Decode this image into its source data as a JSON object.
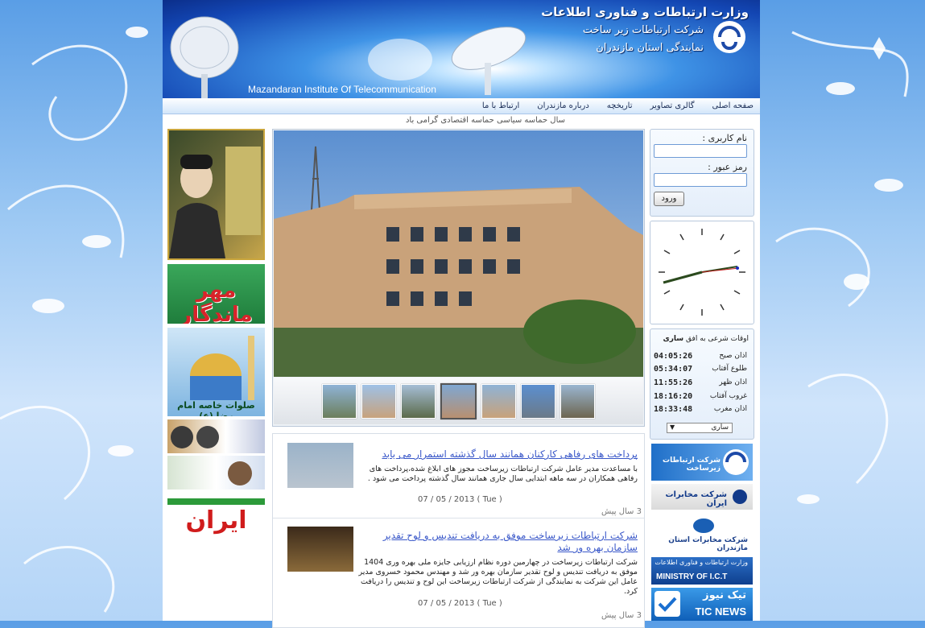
{
  "header": {
    "ministry": "وزارت ارتباطات و فناوری اطلاعات",
    "company": "شرکت ارتباطات زیر ساخت",
    "branch": "نمایندگی استان مازندران",
    "english": "Mazandaran Institute Of Telecommunication"
  },
  "nav": {
    "items": [
      "صفحه اصلی",
      "گالری تصاویر",
      "تاریخچه",
      "درباره مازندران",
      "ارتباط با ما"
    ]
  },
  "ticker": "سال حماسه سیاسی حماسه اقتصادی گرامی باد",
  "left_banners": {
    "mehr": "مهر ماندگار",
    "salavat": "صلوات خاصه امام رضا (ع)",
    "iran": "ایران"
  },
  "login": {
    "username_label": "نام کاربری :",
    "password_label": "رمز عبور :",
    "submit_label": "ورود"
  },
  "prayer": {
    "title": "اوقات شرعی به افق",
    "city": "ساری",
    "rows": [
      {
        "name": "اذان صبح",
        "time": "04:05:26"
      },
      {
        "name": "طلوع آفتاب",
        "time": "05:34:07"
      },
      {
        "name": "اذان ظهر",
        "time": "11:55:26"
      },
      {
        "name": "غروب آفتاب",
        "time": "18:16:20"
      },
      {
        "name": "اذان مغرب",
        "time": "18:33:48"
      }
    ],
    "select_value": "ساری"
  },
  "news": [
    {
      "title": "پرداخت های رفاهی کارکنان همانند سال گذشته استمرار می یابد",
      "body": "با مساعدت مدیر عامل شرکت ارتباطات زیرساخت مجوز های ابلاغ شده،پرداخت های رفاهی همکاران در سه ماهه ابتدایی سال جاری همانند سال گذشته پرداخت می شود .",
      "date": "07 / 05 / 2013 ( Tue )",
      "ago": "3 سال پیش"
    },
    {
      "title": "شرکت ارتباطات زیرساخت موفق به دریافت تندیس و لوح تقدیر سازمان بهره ور شد",
      "body": "شرکت ارتباطات زیرساخت در چهارمین دوره نظام ارزیابی جایزه ملی بهره وری 1404 موفق به دریافت تندیس و لوح تقدیر سازمان بهره ور شد و مهندس محمود خسروی مدیر عامل این شرکت به نمایندگی از شرکت ارتباطات زیرساخت این لوح و تندیس را دریافت کرد.",
      "date": "07 / 05 / 2013 ( Tue )",
      "ago": "3 سال پیش"
    }
  ],
  "right_logos": {
    "infra": "شرکت ارتباطات زیرساخت",
    "mokhaberat": "شرکت مخابرات ایران",
    "mazandaran": "شرکت مخابرات استان مازندران",
    "ict_fa": "وزارت ارتباطات و فناوری اطلاعات",
    "ict_en": "MINISTRY OF I.C.T",
    "tic_fa": "تیک نیوز",
    "tic_en": "TIC NEWS"
  }
}
